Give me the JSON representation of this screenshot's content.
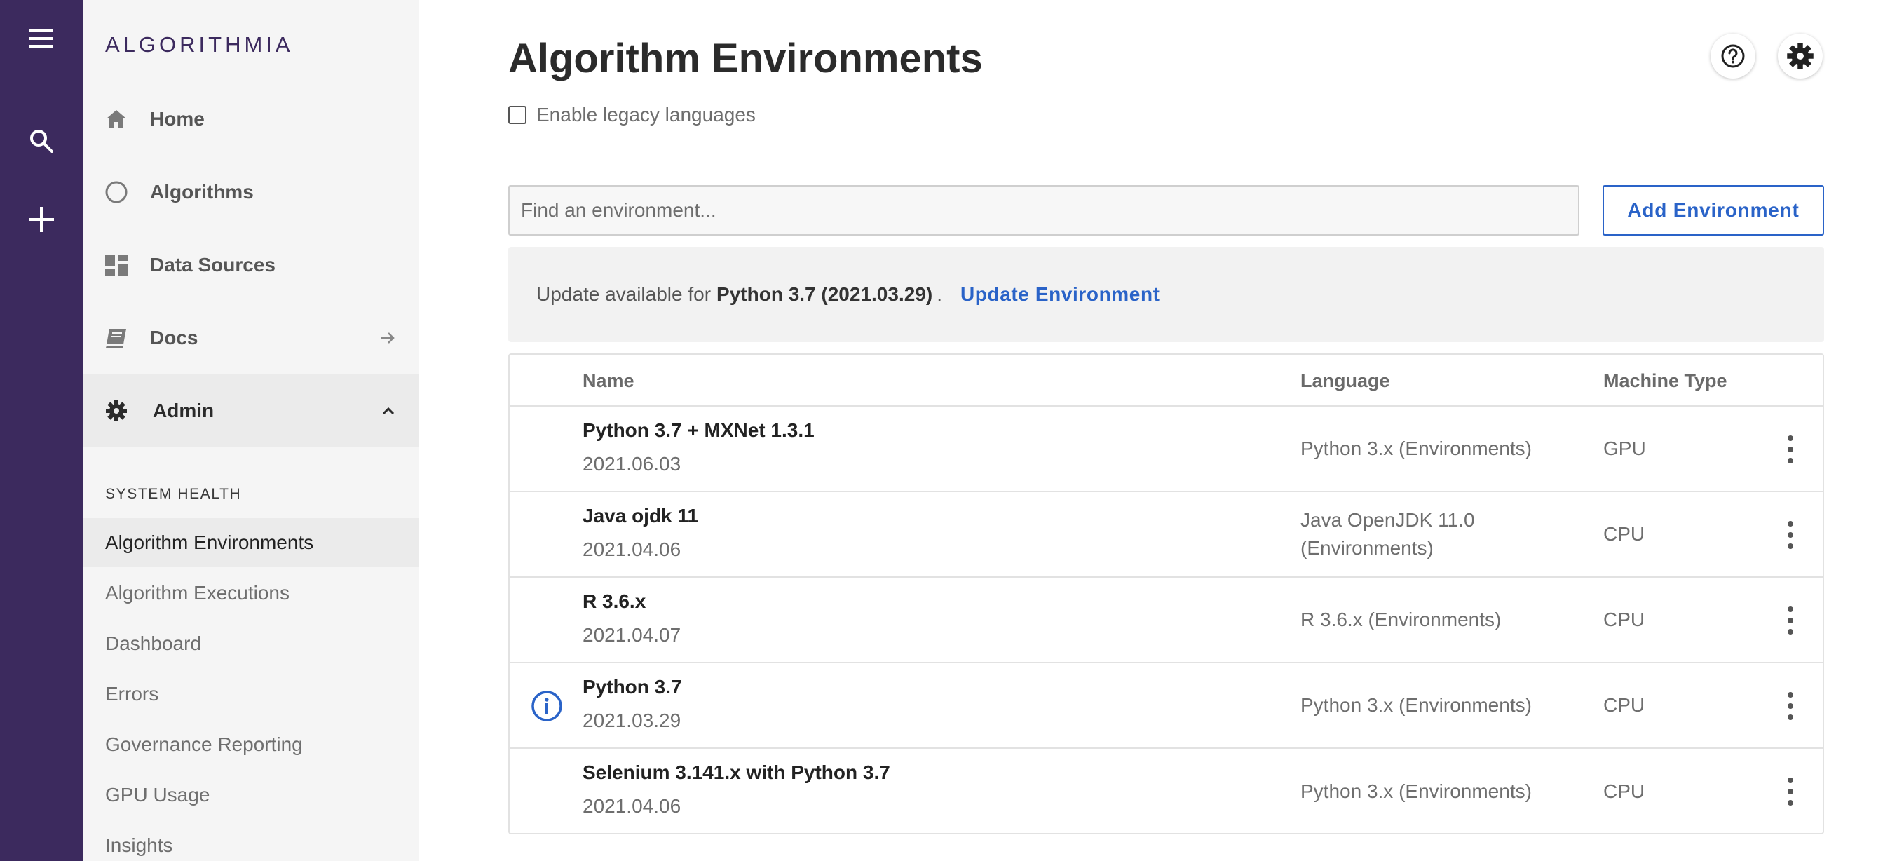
{
  "colors": {
    "rail": "#3c2a5e",
    "accent": "#2a63c8",
    "sidebar_bg": "#f5f5f5"
  },
  "rail": {
    "icons": [
      "menu-icon",
      "search-icon",
      "plus-icon"
    ]
  },
  "sidebar": {
    "logo": "ALGORITHMIA",
    "nav": [
      {
        "label": "Home",
        "icon": "home-icon"
      },
      {
        "label": "Algorithms",
        "icon": "circle-icon"
      },
      {
        "label": "Data Sources",
        "icon": "dashboard-icon"
      },
      {
        "label": "Docs",
        "icon": "book-icon"
      },
      {
        "label": "Admin",
        "icon": "gear-icon"
      }
    ],
    "section_title": "SYSTEM HEALTH",
    "sub_items": [
      "Algorithm Environments",
      "Algorithm Executions",
      "Dashboard",
      "Errors",
      "Governance Reporting",
      "GPU Usage",
      "Insights"
    ]
  },
  "header": {
    "title": "Algorithm Environments"
  },
  "legacy": {
    "label": "Enable legacy languages",
    "checked": false
  },
  "search": {
    "placeholder": "Find an environment...",
    "value": ""
  },
  "add_button": "Add Environment",
  "banner": {
    "prefix": "Update available for",
    "env": "Python 3.7 (2021.03.29)",
    "suffix": ".",
    "link": "Update Environment"
  },
  "table": {
    "columns": [
      "Name",
      "Language",
      "Machine Type"
    ],
    "rows": [
      {
        "name": "Python 3.7 + MXNet 1.3.1",
        "version": "2021.06.03",
        "language": "Python 3.x (Environments)",
        "machine": "GPU"
      },
      {
        "name": "Java ojdk 11",
        "version": "2021.04.06",
        "language": "Java OpenJDK 11.0 (Environments)",
        "machine": "CPU"
      },
      {
        "name": "R 3.6.x",
        "version": "2021.04.07",
        "language": "R 3.6.x (Environments)",
        "machine": "CPU"
      },
      {
        "name": "Python 3.7",
        "version": "2021.03.29",
        "language": "Python 3.x (Environments)",
        "machine": "CPU",
        "info_icon": "info-icon"
      },
      {
        "name": "Selenium 3.141.x with Python 3.7",
        "version": "2021.04.06",
        "language": "Python 3.x (Environments)",
        "machine": "CPU"
      }
    ]
  }
}
